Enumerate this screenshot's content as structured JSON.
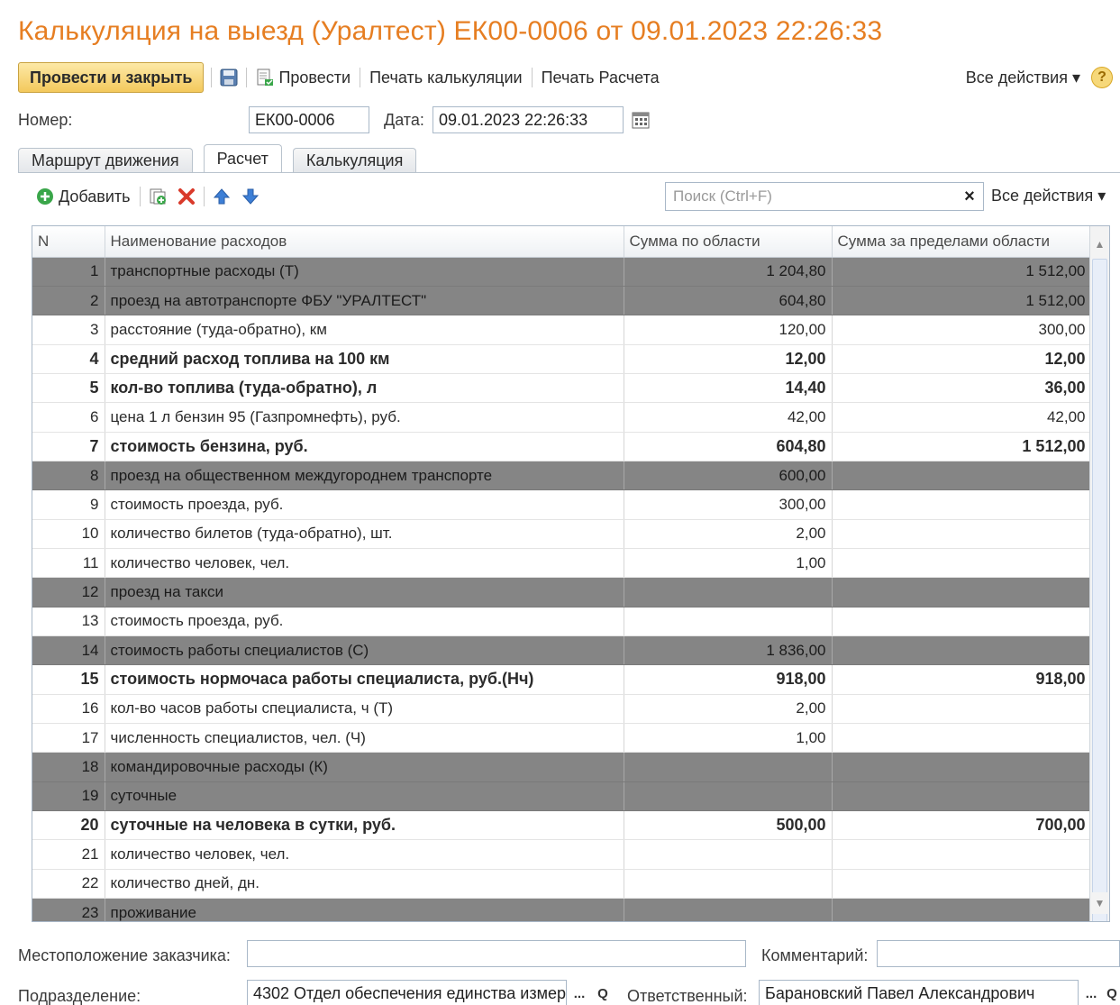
{
  "window": {
    "title": "Калькуляция на выезд (Уралтест) ЕК00-0006 от 09.01.2023 22:26:33"
  },
  "toolbar": {
    "post_close_label": "Провести и закрыть",
    "post_label": "Провести",
    "print_calc_label": "Печать калькуляции",
    "print_rasch_label": "Печать Расчета",
    "all_actions_label": "Все действия ▾",
    "help_label": "?"
  },
  "header": {
    "number_label": "Номер:",
    "number_value": "ЕК00-0006",
    "date_label": "Дата:",
    "date_value": "09.01.2023 22:26:33"
  },
  "tabs": [
    {
      "label": "Маршрут движения"
    },
    {
      "label": "Расчет"
    },
    {
      "label": "Калькуляция"
    }
  ],
  "panel_toolbar": {
    "add_label": "Добавить",
    "search_placeholder": "Поиск (Ctrl+F)",
    "clear_label": "×",
    "all_actions_label": "Все действия ▾"
  },
  "table": {
    "columns": [
      "N",
      "Наименование расходов",
      "Сумма по области",
      "Сумма за пределами области"
    ],
    "rows": [
      {
        "n": "1",
        "name": "транспортные расходы (Т)",
        "in_region": "1 204,80",
        "out_region": "1 512,00",
        "style": "dark"
      },
      {
        "n": "2",
        "name": "проезд на автотранспорте ФБУ \"УРАЛТЕСТ\"",
        "in_region": "604,80",
        "out_region": "1 512,00",
        "style": "dark"
      },
      {
        "n": "3",
        "name": "расстояние (туда-обратно), км",
        "in_region": "120,00",
        "out_region": "300,00",
        "style": "normal"
      },
      {
        "n": "4",
        "name": "средний расход топлива на 100 км",
        "in_region": "12,00",
        "out_region": "12,00",
        "style": "bold"
      },
      {
        "n": "5",
        "name": "кол-во топлива (туда-обратно), л",
        "in_region": "14,40",
        "out_region": "36,00",
        "style": "bold"
      },
      {
        "n": "6",
        "name": "цена 1 л бензин 95 (Газпромнефть), руб.",
        "in_region": "42,00",
        "out_region": "42,00",
        "style": "normal"
      },
      {
        "n": "7",
        "name": "стоимость бензина, руб.",
        "in_region": "604,80",
        "out_region": "1 512,00",
        "style": "bold"
      },
      {
        "n": "8",
        "name": "проезд на общественном междугороднем транспорте",
        "in_region": "600,00",
        "out_region": "",
        "style": "dark"
      },
      {
        "n": "9",
        "name": "стоимость проезда, руб.",
        "in_region": "300,00",
        "out_region": "",
        "style": "normal"
      },
      {
        "n": "10",
        "name": "количество билетов (туда-обратно), шт.",
        "in_region": "2,00",
        "out_region": "",
        "style": "normal"
      },
      {
        "n": "11",
        "name": "количество человек, чел.",
        "in_region": "1,00",
        "out_region": "",
        "style": "normal"
      },
      {
        "n": "12",
        "name": "проезд на такси",
        "in_region": "",
        "out_region": "",
        "style": "dark"
      },
      {
        "n": "13",
        "name": "стоимость проезда, руб.",
        "in_region": "",
        "out_region": "",
        "style": "normal"
      },
      {
        "n": "14",
        "name": "стоимость работы специалистов (С)",
        "in_region": "1 836,00",
        "out_region": "",
        "style": "dark"
      },
      {
        "n": "15",
        "name": "стоимость нормочаса работы специалиста, руб.(Нч)",
        "in_region": "918,00",
        "out_region": "918,00",
        "style": "bold"
      },
      {
        "n": "16",
        "name": "кол-во часов работы специалиста, ч (Т)",
        "in_region": "2,00",
        "out_region": "",
        "style": "normal"
      },
      {
        "n": "17",
        "name": "численность специалистов, чел. (Ч)",
        "in_region": "1,00",
        "out_region": "",
        "style": "normal"
      },
      {
        "n": "18",
        "name": "командировочные расходы (К)",
        "in_region": "",
        "out_region": "",
        "style": "dark"
      },
      {
        "n": "19",
        "name": "суточные",
        "in_region": "",
        "out_region": "",
        "style": "dark"
      },
      {
        "n": "20",
        "name": "суточные на человека в сутки, руб.",
        "in_region": "500,00",
        "out_region": "700,00",
        "style": "bold"
      },
      {
        "n": "21",
        "name": "количество человек, чел.",
        "in_region": "",
        "out_region": "",
        "style": "normal"
      },
      {
        "n": "22",
        "name": "количество дней, дн.",
        "in_region": "",
        "out_region": "",
        "style": "normal"
      },
      {
        "n": "23",
        "name": "проживание",
        "in_region": "",
        "out_region": "",
        "style": "dark"
      }
    ]
  },
  "footer": {
    "location_label": "Местоположение заказчика:",
    "location_value": "",
    "comment_label": "Комментарий:",
    "comment_value": "",
    "department_label": "Подразделение:",
    "department_value": "4302 Отдел обеспечения единства измер",
    "responsible_label": "Ответственный:",
    "responsible_value": "Барановский Павел Александрович",
    "select_label": "...",
    "open_label": "Q"
  },
  "colors": {
    "title": "#e67e22",
    "dark_row": "#858585",
    "main_button": "#f3c95c",
    "delete_icon": "#d93a2b",
    "add_icon": "#3aa64a",
    "arrow_icon": "#3d7fd6"
  }
}
